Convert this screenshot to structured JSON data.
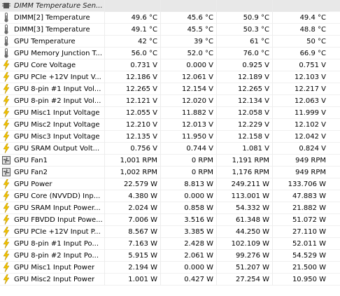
{
  "section": {
    "title": "DIMM Temperature Sen..."
  },
  "rows": [
    {
      "label": "DIMM[2] Temperature",
      "icon": "thermometer-icon",
      "current": "49.6 °C",
      "min": "45.6 °C",
      "max": "50.9 °C",
      "avg": "49.4 °C"
    },
    {
      "label": "DIMM[3] Temperature",
      "icon": "thermometer-icon",
      "current": "49.1 °C",
      "min": "45.5 °C",
      "max": "50.3 °C",
      "avg": "48.8 °C"
    },
    {
      "label": "GPU Temperature",
      "icon": "thermometer-icon",
      "current": "42 °C",
      "min": "39 °C",
      "max": "61 °C",
      "avg": "50 °C"
    },
    {
      "label": "GPU Memory Junction T...",
      "icon": "thermometer-icon",
      "current": "56.0 °C",
      "min": "52.0 °C",
      "max": "76.0 °C",
      "avg": "66.9 °C"
    },
    {
      "label": "GPU Core Voltage",
      "icon": "lightning-icon",
      "current": "0.731 V",
      "min": "0.000 V",
      "max": "0.925 V",
      "avg": "0.751 V"
    },
    {
      "label": "GPU PCIe +12V Input V...",
      "icon": "lightning-icon",
      "current": "12.186 V",
      "min": "12.061 V",
      "max": "12.189 V",
      "avg": "12.103 V"
    },
    {
      "label": "GPU 8-pin #1 Input Vol...",
      "icon": "lightning-icon",
      "current": "12.265 V",
      "min": "12.154 V",
      "max": "12.265 V",
      "avg": "12.217 V"
    },
    {
      "label": "GPU 8-pin #2 Input Vol...",
      "icon": "lightning-icon",
      "current": "12.121 V",
      "min": "12.020 V",
      "max": "12.134 V",
      "avg": "12.063 V"
    },
    {
      "label": "GPU Misc1 Input Voltage",
      "icon": "lightning-icon",
      "current": "12.055 V",
      "min": "11.882 V",
      "max": "12.058 V",
      "avg": "11.999 V"
    },
    {
      "label": "GPU Misc2 Input Voltage",
      "icon": "lightning-icon",
      "current": "12.210 V",
      "min": "12.013 V",
      "max": "12.229 V",
      "avg": "12.102 V"
    },
    {
      "label": "GPU Misc3 Input Voltage",
      "icon": "lightning-icon",
      "current": "12.135 V",
      "min": "11.950 V",
      "max": "12.158 V",
      "avg": "12.042 V"
    },
    {
      "label": "GPU SRAM Output Volt...",
      "icon": "lightning-icon",
      "current": "0.756 V",
      "min": "0.744 V",
      "max": "1.081 V",
      "avg": "0.824 V"
    },
    {
      "label": "GPU Fan1",
      "icon": "fan-icon",
      "current": "1,001 RPM",
      "min": "0 RPM",
      "max": "1,191 RPM",
      "avg": "949 RPM"
    },
    {
      "label": "GPU Fan2",
      "icon": "fan-icon",
      "current": "1,002 RPM",
      "min": "0 RPM",
      "max": "1,176 RPM",
      "avg": "949 RPM"
    },
    {
      "label": "GPU Power",
      "icon": "lightning-icon",
      "current": "22.579 W",
      "min": "8.813 W",
      "max": "249.211 W",
      "avg": "133.706 W"
    },
    {
      "label": "GPU Core (NVVDD) Inp...",
      "icon": "lightning-icon",
      "current": "4.380 W",
      "min": "0.000 W",
      "max": "113.001 W",
      "avg": "47.883 W"
    },
    {
      "label": "GPU SRAM Input Power...",
      "icon": "lightning-icon",
      "current": "2.024 W",
      "min": "0.858 W",
      "max": "54.332 W",
      "avg": "21.882 W"
    },
    {
      "label": "GPU FBVDD Input Powe...",
      "icon": "lightning-icon",
      "current": "7.006 W",
      "min": "3.516 W",
      "max": "61.348 W",
      "avg": "51.072 W"
    },
    {
      "label": "GPU PCIe +12V Input P...",
      "icon": "lightning-icon",
      "current": "8.567 W",
      "min": "3.385 W",
      "max": "44.250 W",
      "avg": "27.110 W"
    },
    {
      "label": "GPU 8-pin #1 Input Po...",
      "icon": "lightning-icon",
      "current": "7.163 W",
      "min": "2.428 W",
      "max": "102.109 W",
      "avg": "52.011 W"
    },
    {
      "label": "GPU 8-pin #2 Input Po...",
      "icon": "lightning-icon",
      "current": "5.915 W",
      "min": "2.061 W",
      "max": "99.276 W",
      "avg": "54.529 W"
    },
    {
      "label": "GPU Misc1 Input Power",
      "icon": "lightning-icon",
      "current": "2.194 W",
      "min": "0.000 W",
      "max": "51.207 W",
      "avg": "21.500 W"
    },
    {
      "label": "GPU Misc2 Input Power",
      "icon": "lightning-icon",
      "current": "1.001 W",
      "min": "0.427 W",
      "max": "27.254 W",
      "avg": "10.950 W"
    }
  ],
  "colors": {
    "lightning": "#f2c200",
    "thermometer": "#6b6b6b",
    "fan": "#5a5a5a",
    "section_bg": "#e8e8e8"
  }
}
